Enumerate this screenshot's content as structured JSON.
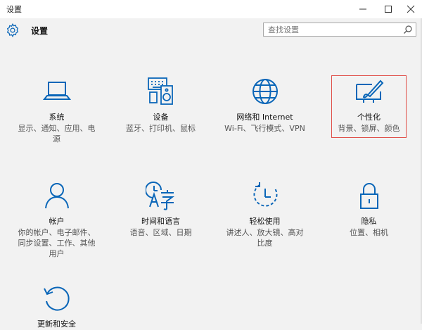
{
  "window": {
    "title": "设置"
  },
  "header": {
    "title": "设置"
  },
  "search": {
    "placeholder": "查找设置"
  },
  "accent": "#0a66b8",
  "tiles": [
    {
      "name": "系统",
      "desc": "显示、通知、应用、电源",
      "icon": "laptop-icon"
    },
    {
      "name": "设备",
      "desc": "蓝牙、打印机、鼠标",
      "icon": "devices-icon"
    },
    {
      "name": "网络和 Internet",
      "desc": "Wi-Fi、飞行模式、VPN",
      "icon": "globe-icon"
    },
    {
      "name": "个性化",
      "desc": "背景、锁屏、颜色",
      "icon": "paint-brush-icon"
    },
    {
      "name": "帐户",
      "desc": "你的帐户、电子邮件、同步设置、工作、其他用户",
      "icon": "person-icon"
    },
    {
      "name": "时间和语言",
      "desc": "语音、区域、日期",
      "icon": "time-language-icon"
    },
    {
      "name": "轻松使用",
      "desc": "讲述人、放大镜、高对比度",
      "icon": "ease-of-access-icon"
    },
    {
      "name": "隐私",
      "desc": "位置、相机",
      "icon": "lock-icon"
    },
    {
      "name": "更新和安全",
      "desc": "",
      "icon": "update-icon"
    }
  ]
}
